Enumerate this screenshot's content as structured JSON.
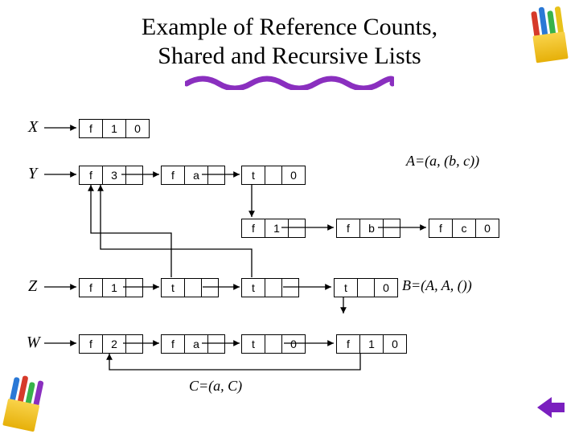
{
  "title_line1": "Example of Reference Counts,",
  "title_line2": "Shared and Recursive Lists",
  "labels": {
    "X": "X",
    "Y": "Y",
    "Z": "Z",
    "W": "W"
  },
  "tags": {
    "f": "f",
    "t": "t",
    "a": "a",
    "b": "b",
    "c": "c",
    "n0": "0",
    "n1": "1",
    "n2": "2",
    "n3": "3"
  },
  "equations": {
    "A": "A=(a, (b, c))",
    "B": "B=(A, A, ())",
    "C": "C=(a, C)"
  },
  "chart_data": {
    "type": "table",
    "description": "Linked-list cons-cell diagram with reference counts",
    "nodes": {
      "X": {
        "tag": "f",
        "ref": 1,
        "payload": "0"
      },
      "Y": {
        "tag": "f",
        "ref": 3
      },
      "Y2": {
        "tag": "f",
        "payload": "a"
      },
      "Y3": {
        "tag": "t",
        "next": "0"
      },
      "M1": {
        "tag": "f",
        "ref": 1
      },
      "M2": {
        "tag": "f",
        "payload": "b"
      },
      "M3": {
        "tag": "f",
        "payload": "c",
        "next": "0"
      },
      "Z": {
        "tag": "f",
        "ref": 1
      },
      "Z2": {
        "tag": "t"
      },
      "Z3": {
        "tag": "t"
      },
      "Z4": {
        "tag": "t",
        "next": "0"
      },
      "W": {
        "tag": "f",
        "ref": 2
      },
      "W2": {
        "tag": "f",
        "payload": "a"
      },
      "W3": {
        "tag": "t",
        "next": "0"
      },
      "W4": {
        "tag": "f",
        "ref": 1,
        "next": "0"
      }
    },
    "edges": [
      [
        "Y",
        "Y2"
      ],
      [
        "Y2",
        "Y3"
      ],
      [
        "Y3",
        "M1"
      ],
      [
        "M1",
        "M2"
      ],
      [
        "M2",
        "M3"
      ],
      [
        "Z",
        "Z2"
      ],
      [
        "Z2",
        "Z3"
      ],
      [
        "Z3",
        "Z4"
      ],
      [
        "Z2",
        "Y"
      ],
      [
        "Z3",
        "Y"
      ],
      [
        "W",
        "W2"
      ],
      [
        "W2",
        "W3"
      ],
      [
        "W3",
        "W4"
      ],
      [
        "W4",
        "W"
      ]
    ],
    "list_equations": {
      "A": "A=(a,(b,c))",
      "B": "B=(A,A,())",
      "C": "C=(a,C)"
    }
  }
}
